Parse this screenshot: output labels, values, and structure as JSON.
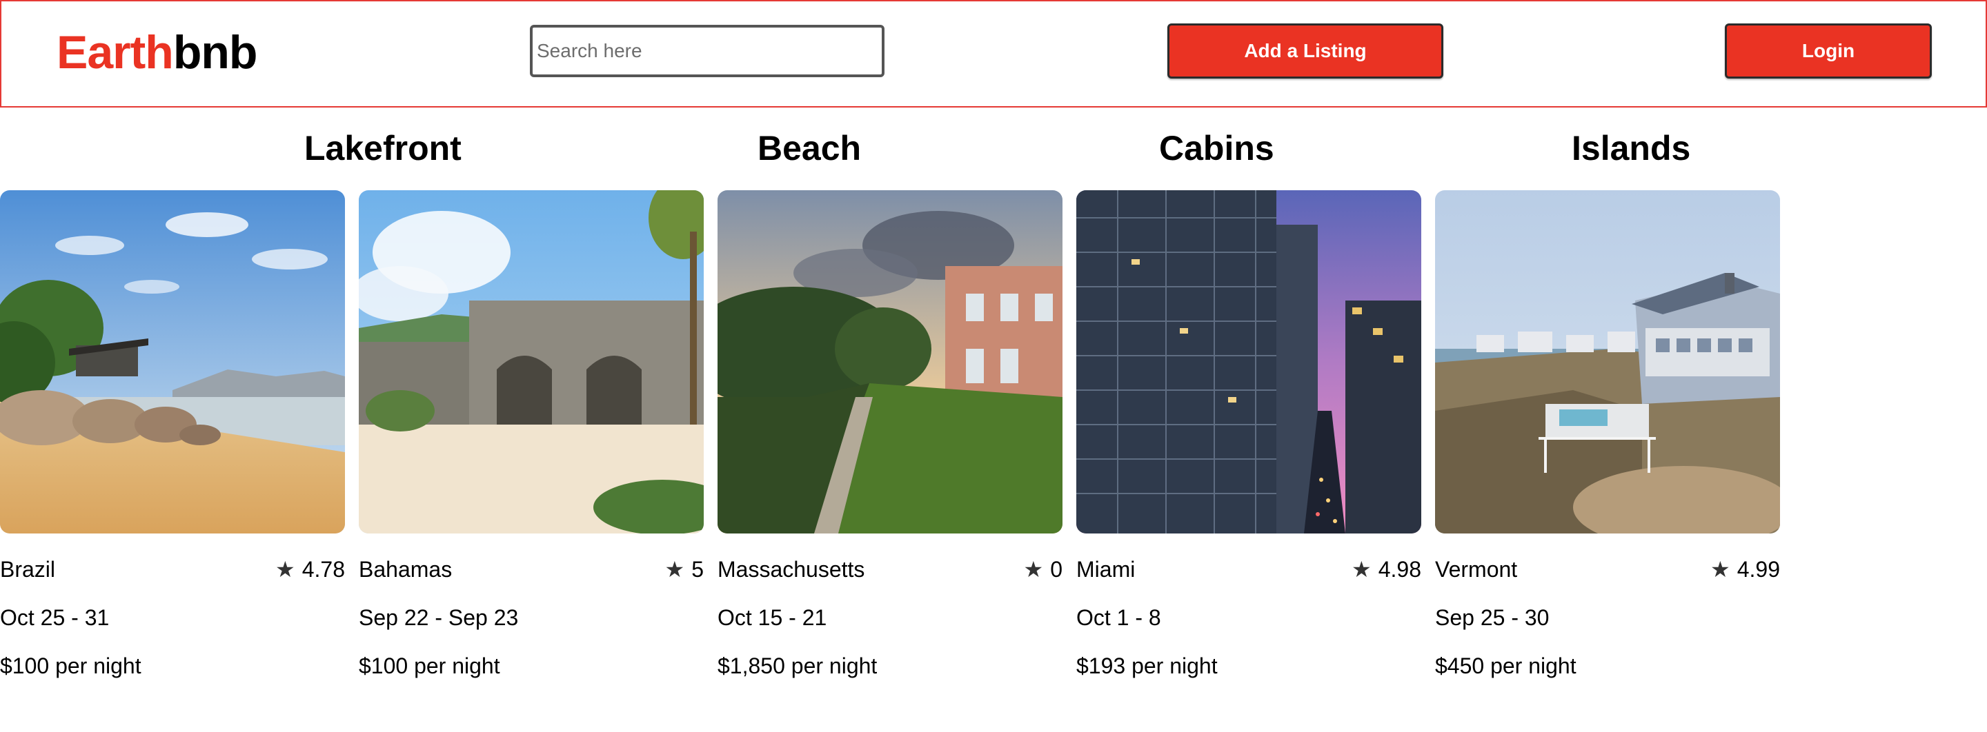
{
  "header": {
    "logo_part1": "Earth",
    "logo_part2": "bnb",
    "search_placeholder": "Search here",
    "add_listing_label": "Add a Listing",
    "login_label": "Login",
    "accent_color": "#ea3323"
  },
  "categories": [
    {
      "label": "Lakefront"
    },
    {
      "label": "Beach"
    },
    {
      "label": "Cabins"
    },
    {
      "label": "Islands"
    }
  ],
  "listings": [
    {
      "location": "Brazil",
      "rating": "4.78",
      "dates": "Oct 25 - 31",
      "price": "$100 per night",
      "image": "tropical-beach-house"
    },
    {
      "location": "Bahamas",
      "rating": "5",
      "dates": "Sep 22 - Sep 23",
      "price": "$100 per night",
      "image": "stone-fort-on-beach"
    },
    {
      "location": "Massachusetts",
      "rating": "0",
      "dates": "Oct 15 - 21",
      "price": "$1,850 per night",
      "image": "seaside-mansion-lawn"
    },
    {
      "location": "Miami",
      "rating": "4.98",
      "dates": "Oct 1 - 8",
      "price": "$193 per night",
      "image": "city-skyscrapers-dusk"
    },
    {
      "location": "Vermont",
      "rating": "4.99",
      "dates": "Sep 25 - 30",
      "price": "$450 per night",
      "image": "coastal-house-on-cliff"
    }
  ],
  "rating_icon": "star-icon"
}
